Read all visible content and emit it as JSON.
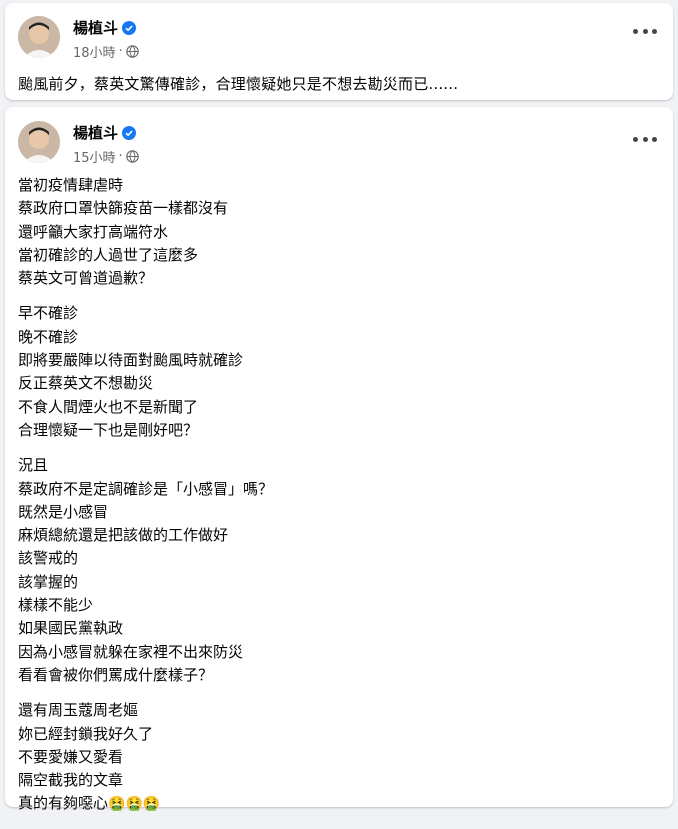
{
  "post1": {
    "author": "楊植斗",
    "time": "18小時",
    "text": "颱風前夕，蔡英文驚傳確診，合理懷疑她只是不想去勘災而已......",
    "icons": [
      "avatar",
      "verified-badge-icon",
      "globe-icon",
      "more-options-icon"
    ]
  },
  "post2": {
    "author": "楊植斗",
    "time": "15小時",
    "paragraphs": [
      [
        "當初疫情肆虐時",
        "蔡政府口罩快篩疫苗一樣都沒有",
        "還呼籲大家打高端符水",
        "當初確診的人過世了這麼多",
        "蔡英文可曾道過歉？"
      ],
      [
        "早不確診",
        "晚不確診",
        "即將要嚴陣以待面對颱風時就確診",
        "反正蔡英文不想勘災",
        "不食人間煙火也不是新聞了",
        "合理懷疑一下也是剛好吧？"
      ],
      [
        "況且",
        "蔡政府不是定調確診是「小感冒」嗎？",
        "既然是小感冒",
        "麻煩總統還是把該做的工作做好",
        "該警戒的",
        "該掌握的",
        "樣樣不能少",
        "如果國民黨執政",
        "因為小感冒就躲在家裡不出來防災",
        "看看會被你們罵成什麼樣子？"
      ],
      [
        "還有周玉蔻周老嫗",
        "妳已經封鎖我好久了",
        "不要愛嫌又愛看",
        "隔空截我的文章",
        "真的有夠噁心"
      ]
    ],
    "last_line_emoji": "🤮🤮🤮",
    "colors": {
      "verified": "#1877f2",
      "meta": "#65676b",
      "background": "#f0f2f5"
    }
  }
}
